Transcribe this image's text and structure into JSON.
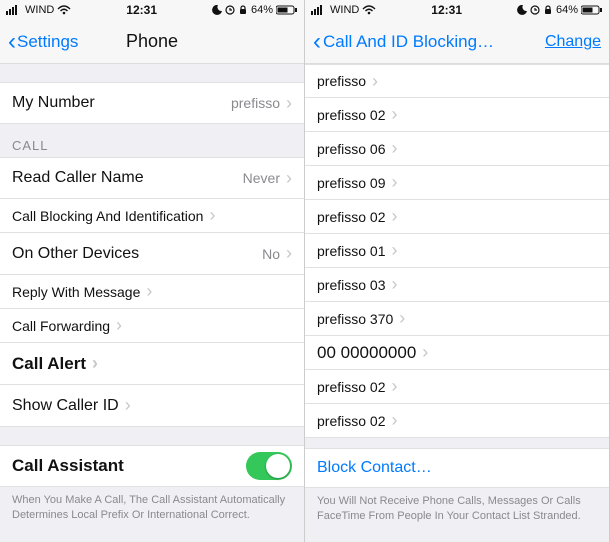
{
  "status": {
    "carrier": "WIND",
    "wifi_icon": "wifi",
    "time": "12:31",
    "battery_text": "64%"
  },
  "left": {
    "back_label": "Settings",
    "title": "Phone",
    "my_number": {
      "label": "My Number",
      "value": "prefisso"
    },
    "calls_header": "CALL",
    "read_caller_name": {
      "label": "Read Caller Name",
      "value": "Never"
    },
    "call_blocking": {
      "label": "Call Blocking And Identification"
    },
    "other_devices": {
      "label": "On Other Devices",
      "value": "No"
    },
    "reply_msg": {
      "label": "Reply With Message"
    },
    "forwarding": {
      "label": "Call Forwarding"
    },
    "call_alert": {
      "label": "Call Alert"
    },
    "show_caller_id": {
      "label": "Show Caller ID"
    },
    "call_assistant": {
      "label": "Call Assistant"
    },
    "footer": "When You Make A Call, The Call Assistant Automatically Determines Local Prefix Or International Correct."
  },
  "right": {
    "title": "Call And ID Blocking…",
    "action": "Change",
    "list": [
      "prefisso",
      "prefisso 02",
      "prefisso 06",
      "prefisso 09",
      "prefisso 02",
      "prefisso 01",
      "prefisso 03",
      "prefisso 370",
      "00 00000000",
      "prefisso 02",
      "prefisso 02"
    ],
    "block_contact": "Block Contact…",
    "footer": "You Will Not Receive Phone Calls, Messages Or Calls FaceTime From People In Your Contact List Stranded."
  }
}
